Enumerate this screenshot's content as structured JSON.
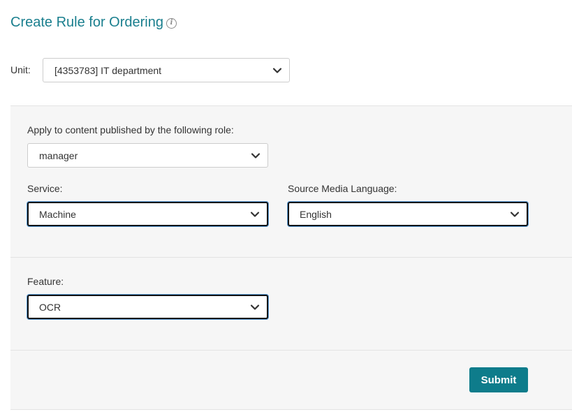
{
  "header": {
    "title": "Create Rule for Ordering",
    "info_icon": "i"
  },
  "unit": {
    "label": "Unit:",
    "selected": "[4353783] IT department"
  },
  "role": {
    "label": "Apply to content published by the following role:",
    "selected": "manager"
  },
  "service": {
    "label": "Service:",
    "selected": "Machine"
  },
  "source_language": {
    "label": "Source Media Language:",
    "selected": "English"
  },
  "feature": {
    "label": "Feature:",
    "selected": "OCR"
  },
  "actions": {
    "submit_label": "Submit"
  },
  "colors": {
    "accent": "#1a7f8e",
    "button": "#0e7c8b",
    "panel_bg": "#f6f6f6"
  }
}
